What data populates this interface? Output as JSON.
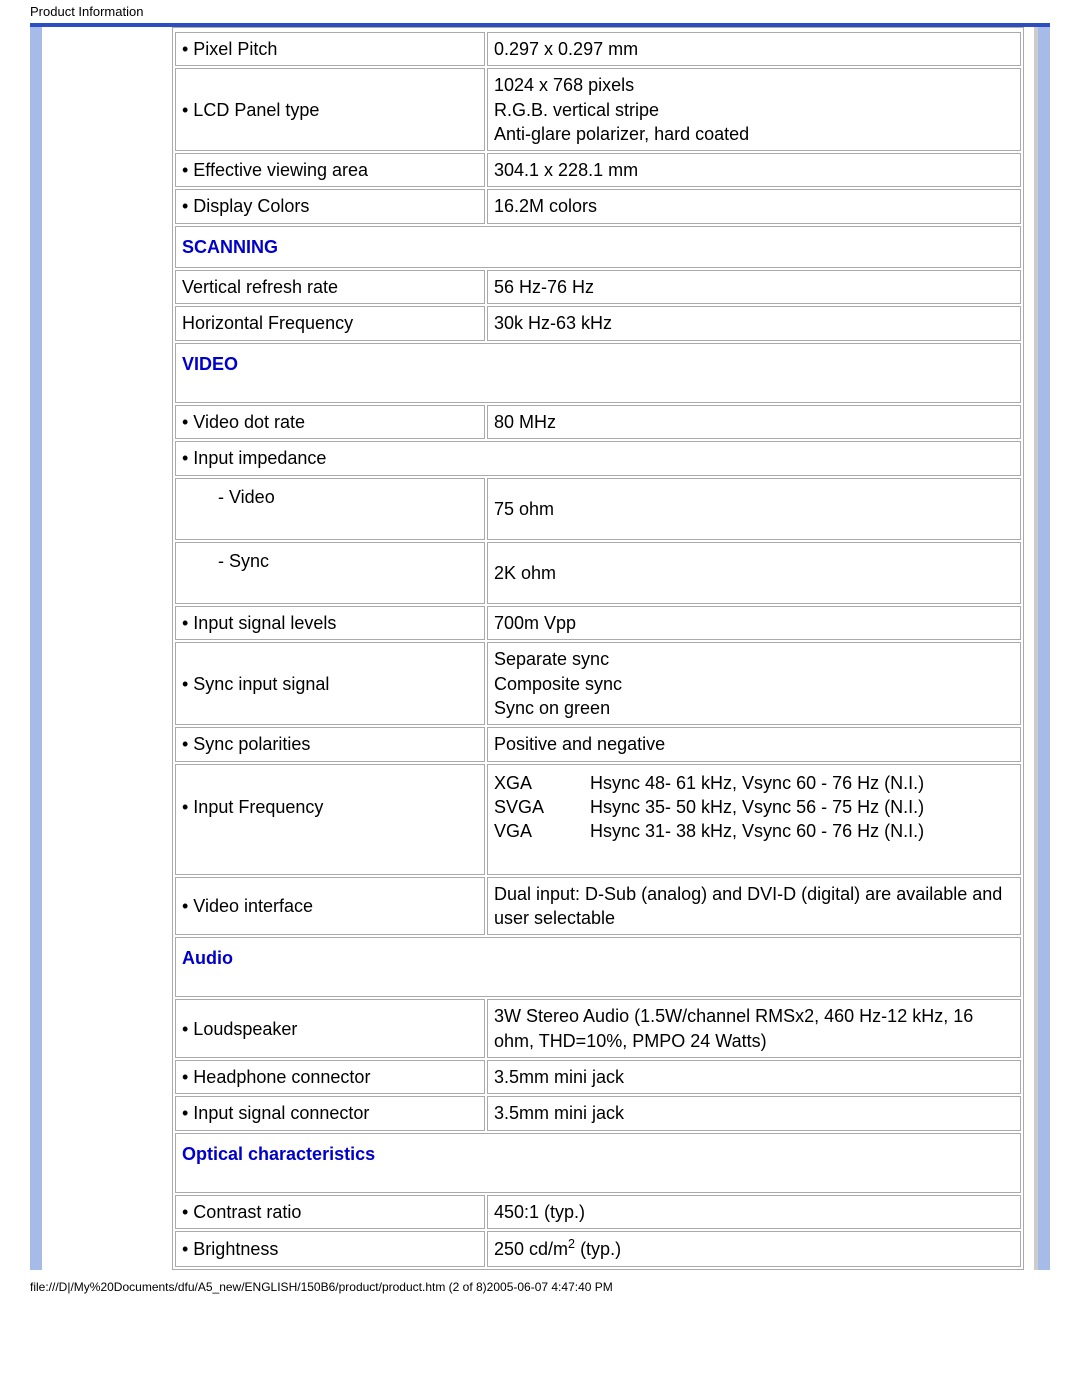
{
  "header": "Product Information",
  "sections": {
    "scanning": "SCANNING",
    "video": "VIDEO",
    "audio": "Audio",
    "optical": "Optical characteristics"
  },
  "specs": {
    "pixel_pitch": {
      "label": "• Pixel Pitch",
      "value": "0.297 x 0.297 mm"
    },
    "lcd_panel_type": {
      "label": "• LCD Panel type",
      "line1": "1024 x 768 pixels",
      "line2": "R.G.B. vertical stripe",
      "line3": "Anti-glare polarizer, hard coated"
    },
    "effective_viewing_area": {
      "label": "• Effective viewing area",
      "value": "304.1 x 228.1 mm"
    },
    "display_colors": {
      "label": "• Display Colors",
      "value": "16.2M colors"
    },
    "vertical_refresh_rate": {
      "label": "Vertical refresh rate",
      "value": "56 Hz-76 Hz"
    },
    "horizontal_frequency": {
      "label": "Horizontal Frequency",
      "value": "30k Hz-63 kHz"
    },
    "video_dot_rate": {
      "label": "• Video dot rate",
      "value": "80 MHz"
    },
    "input_impedance": {
      "label": "• Input impedance"
    },
    "impedance_video": {
      "label": "- Video",
      "value": "75 ohm"
    },
    "impedance_sync": {
      "label": "- Sync",
      "value": "2K ohm"
    },
    "input_signal_levels": {
      "label": "• Input signal levels",
      "value": "700m Vpp"
    },
    "sync_input_signal": {
      "label": "• Sync input signal",
      "line1": "Separate sync",
      "line2": "Composite sync",
      "line3": "Sync on green"
    },
    "sync_polarities": {
      "label": "• Sync polarities",
      "value": "Positive and negative"
    },
    "input_frequency": {
      "label": "• Input Frequency",
      "rows": [
        {
          "mode": "XGA",
          "desc": "Hsync 48- 61 kHz, Vsync 60 - 76 Hz (N.I.)"
        },
        {
          "mode": "SVGA",
          "desc": "Hsync 35- 50 kHz, Vsync 56 - 75 Hz (N.I.)"
        },
        {
          "mode": "VGA",
          "desc": "Hsync 31- 38 kHz, Vsync 60 - 76 Hz (N.I.)"
        }
      ]
    },
    "video_interface": {
      "label": "• Video interface",
      "value": "Dual input: D-Sub (analog) and DVI-D (digital) are available and user selectable"
    },
    "loudspeaker": {
      "label": "• Loudspeaker",
      "value": "3W Stereo Audio (1.5W/channel RMSx2, 460 Hz-12 kHz, 16 ohm, THD=10%, PMPO 24 Watts)"
    },
    "headphone_connector": {
      "label": "• Headphone connector",
      "value": "3.5mm mini jack"
    },
    "input_signal_connector": {
      "label": "• Input signal connector",
      "value": "3.5mm mini jack"
    },
    "contrast_ratio": {
      "label": "• Contrast ratio",
      "value": "450:1 (typ.)"
    },
    "brightness": {
      "label": "• Brightness",
      "value_prefix": "250 cd/m",
      "value_suffix": " (typ.)",
      "sup": "2"
    }
  },
  "footer": "file:///D|/My%20Documents/dfu/A5_new/ENGLISH/150B6/product/product.htm (2 of 8)2005-06-07 4:47:40 PM"
}
